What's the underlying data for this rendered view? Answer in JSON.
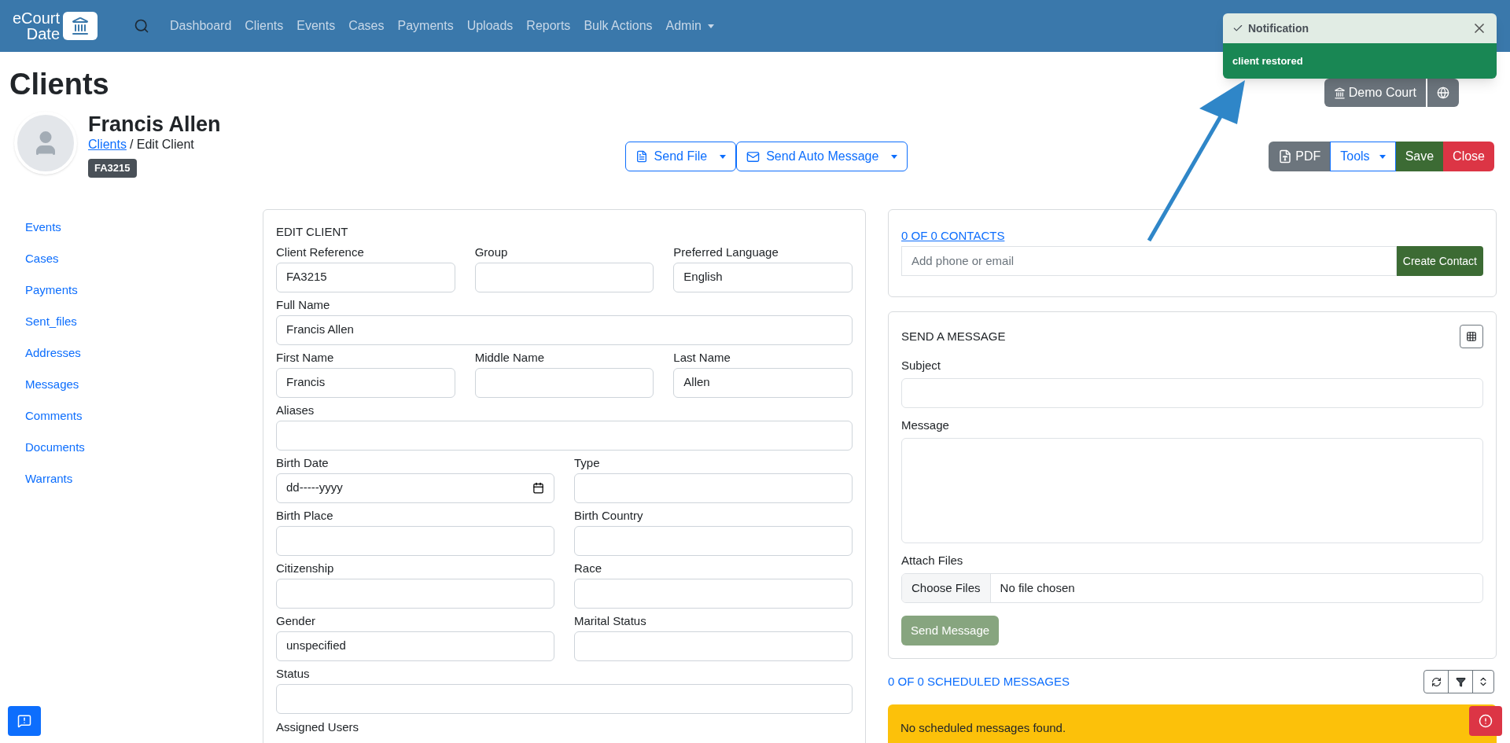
{
  "navbar": {
    "logo_lines": [
      "eCourt",
      "Date"
    ],
    "links": [
      {
        "label": "Dashboard",
        "dropdown": false
      },
      {
        "label": "Clients",
        "dropdown": false
      },
      {
        "label": "Events",
        "dropdown": false
      },
      {
        "label": "Cases",
        "dropdown": false
      },
      {
        "label": "Payments",
        "dropdown": false
      },
      {
        "label": "Uploads",
        "dropdown": false
      },
      {
        "label": "Reports",
        "dropdown": false
      },
      {
        "label": "Bulk Actions",
        "dropdown": false
      },
      {
        "label": "Admin",
        "dropdown": true
      }
    ]
  },
  "page_title": "Clients",
  "court_button": "Demo Court",
  "notification": {
    "title": "Notification",
    "message": "client restored"
  },
  "client": {
    "name": "Francis Allen",
    "breadcrumb_link": "Clients",
    "breadcrumb_rest": "/ Edit Client",
    "badge": "FA3215"
  },
  "action_buttons": [
    {
      "label": "Send File",
      "kind": "file"
    },
    {
      "label": "Send Auto Message",
      "kind": "envelope"
    }
  ],
  "toolbar_buttons": [
    {
      "label": "PDF",
      "kind": "pdf"
    },
    {
      "label": "Tools",
      "kind": "tools"
    },
    {
      "label": "Save",
      "kind": "save"
    },
    {
      "label": "Close",
      "kind": "close"
    }
  ],
  "sidebar": {
    "items": [
      "Events",
      "Cases",
      "Payments",
      "Sent_files",
      "Addresses",
      "Messages",
      "Comments",
      "Documents",
      "Warrants"
    ]
  },
  "edit_client": {
    "title": "EDIT CLIENT",
    "rows": [
      [
        {
          "label": "Client Reference",
          "value": "FA3215",
          "kind": "text"
        },
        {
          "label": "Group",
          "kind": "text"
        },
        {
          "label": "Preferred Language",
          "value": "English",
          "kind": "text"
        }
      ],
      [
        {
          "label": "Full Name",
          "value": "Francis Allen",
          "kind": "text"
        }
      ],
      [
        {
          "label": "First Name",
          "value": "Francis",
          "kind": "text"
        },
        {
          "label": "Middle Name",
          "kind": "text"
        },
        {
          "label": "Last Name",
          "value": "Allen",
          "kind": "text"
        }
      ],
      [
        {
          "label": "Aliases",
          "kind": "text"
        }
      ],
      [
        {
          "label": "Birth Date",
          "value": "dd-----yyyy",
          "kind": "date"
        },
        {
          "label": "Type",
          "kind": "text"
        }
      ],
      [
        {
          "label": "Birth Place",
          "kind": "text"
        },
        {
          "label": "Birth Country",
          "kind": "text"
        }
      ],
      [
        {
          "label": "Citizenship",
          "kind": "text"
        },
        {
          "label": "Race",
          "kind": "text"
        }
      ],
      [
        {
          "label": "Gender",
          "value": "unspecified",
          "kind": "text"
        },
        {
          "label": "Marital Status",
          "kind": "text"
        }
      ],
      [
        {
          "label": "Status",
          "kind": "text"
        }
      ],
      [
        {
          "label": "Assigned Users",
          "kind": "label"
        }
      ]
    ]
  },
  "contacts": {
    "link": "0 OF 0 CONTACTS",
    "placeholder": "Add phone or email",
    "button": "Create Contact"
  },
  "send_message": {
    "title": "SEND A MESSAGE",
    "subject_label": "Subject",
    "message_label": "Message",
    "attach_label": "Attach Files",
    "choose_button": "Choose Files",
    "no_file": "No file chosen",
    "send_button": "Send Message",
    "send_disabled": true
  },
  "scheduled": {
    "title": "0 OF 0 SCHEDULED MESSAGES",
    "empty": "No scheduled messages found."
  }
}
